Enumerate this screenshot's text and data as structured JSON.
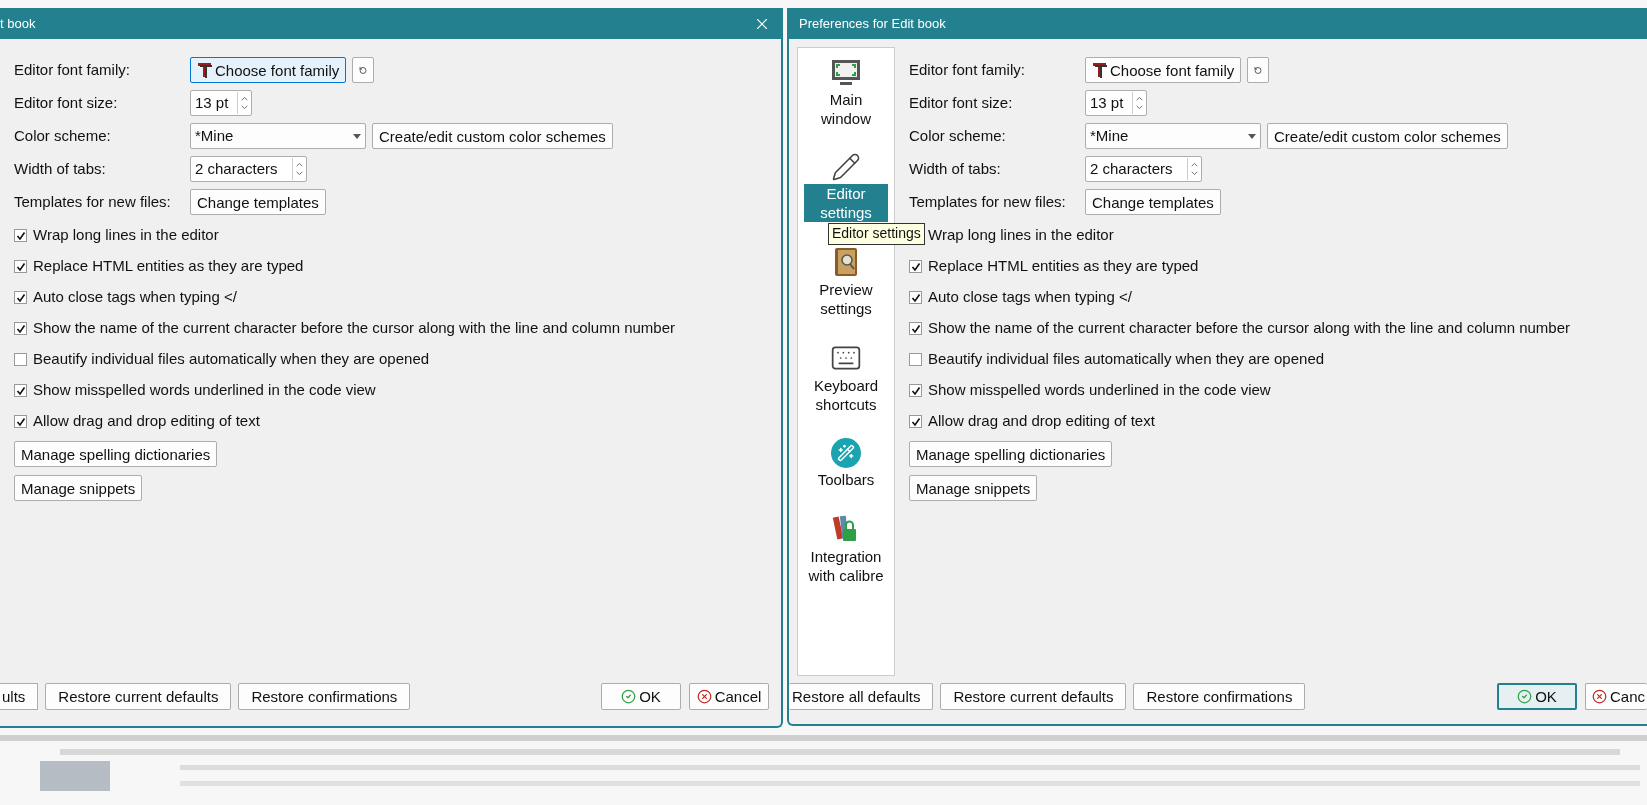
{
  "left_dialog": {
    "title": "t book",
    "form": {
      "font_family": {
        "label": "Editor font family:",
        "button": "Choose font family",
        "focused": true
      },
      "font_size": {
        "label": "Editor font size:",
        "value": "13 pt"
      },
      "color_scheme": {
        "label": "Color scheme:",
        "value": "*Mine",
        "button": "Create/edit custom color schemes"
      },
      "tab_width": {
        "label": "Width of tabs:",
        "value": "2 characters"
      },
      "templates": {
        "label": "Templates for new files:",
        "button": "Change templates"
      }
    },
    "checkboxes": [
      {
        "label": "Wrap long lines in the editor",
        "checked": true
      },
      {
        "label": "Replace HTML entities as they are typed",
        "checked": true
      },
      {
        "label": "Auto close tags when typing </",
        "checked": true
      },
      {
        "label": "Show the name of the current character before the cursor along with the line and column number",
        "checked": true
      },
      {
        "label": "Beautify individual files automatically when they are opened",
        "checked": false
      },
      {
        "label": "Show misspelled words underlined in the code view",
        "checked": true
      },
      {
        "label": "Allow drag and drop editing of text",
        "checked": true
      }
    ],
    "buttons": [
      "Manage spelling dictionaries",
      "Manage snippets"
    ],
    "footer": {
      "restore_buttons": [
        "ults",
        "Restore current defaults",
        "Restore confirmations"
      ],
      "ok": {
        "label": "OK",
        "focused": false
      },
      "cancel": "Cancel"
    }
  },
  "right_dialog": {
    "title": "Preferences for Edit book",
    "sidebar": {
      "items": [
        {
          "label": "Main window",
          "selected": false
        },
        {
          "label": "Editor settings",
          "selected": true
        },
        {
          "label": "Preview settings",
          "selected": false
        },
        {
          "label": "Keyboard shortcuts",
          "selected": false
        },
        {
          "label": "Toolbars",
          "selected": false
        },
        {
          "label": "Integration with calibre",
          "selected": false
        }
      ]
    },
    "tooltip": "Editor settings",
    "form": {
      "font_family": {
        "label": "Editor font family:",
        "button": "Choose font family",
        "focused": false
      },
      "font_size": {
        "label": "Editor font size:",
        "value": "13 pt"
      },
      "color_scheme": {
        "label": "Color scheme:",
        "value": "*Mine",
        "button": "Create/edit custom color schemes"
      },
      "tab_width": {
        "label": "Width of tabs:",
        "value": "2 characters"
      },
      "templates": {
        "label": "Templates for new files:",
        "button": "Change templates"
      }
    },
    "checkboxes": [
      {
        "label": "Wrap long lines in the editor"
      },
      {
        "label": "Replace HTML entities as they are typed",
        "checked": true
      },
      {
        "label": "Auto close tags when typing </",
        "checked": true
      },
      {
        "label": "Show the name of the current character before the cursor along with the line and column number",
        "checked": true
      },
      {
        "label": "Beautify individual files automatically when they are opened",
        "checked": false
      },
      {
        "label": "Show misspelled words underlined in the code view",
        "checked": true
      },
      {
        "label": "Allow drag and drop editing of text",
        "checked": true
      }
    ],
    "buttons": [
      "Manage spelling dictionaries",
      "Manage snippets"
    ],
    "footer": {
      "restore_buttons": [
        "Restore all defaults",
        "Restore current defaults",
        "Restore confirmations"
      ],
      "ok": {
        "label": "OK",
        "focused": true
      },
      "cancel": "Canc"
    }
  }
}
